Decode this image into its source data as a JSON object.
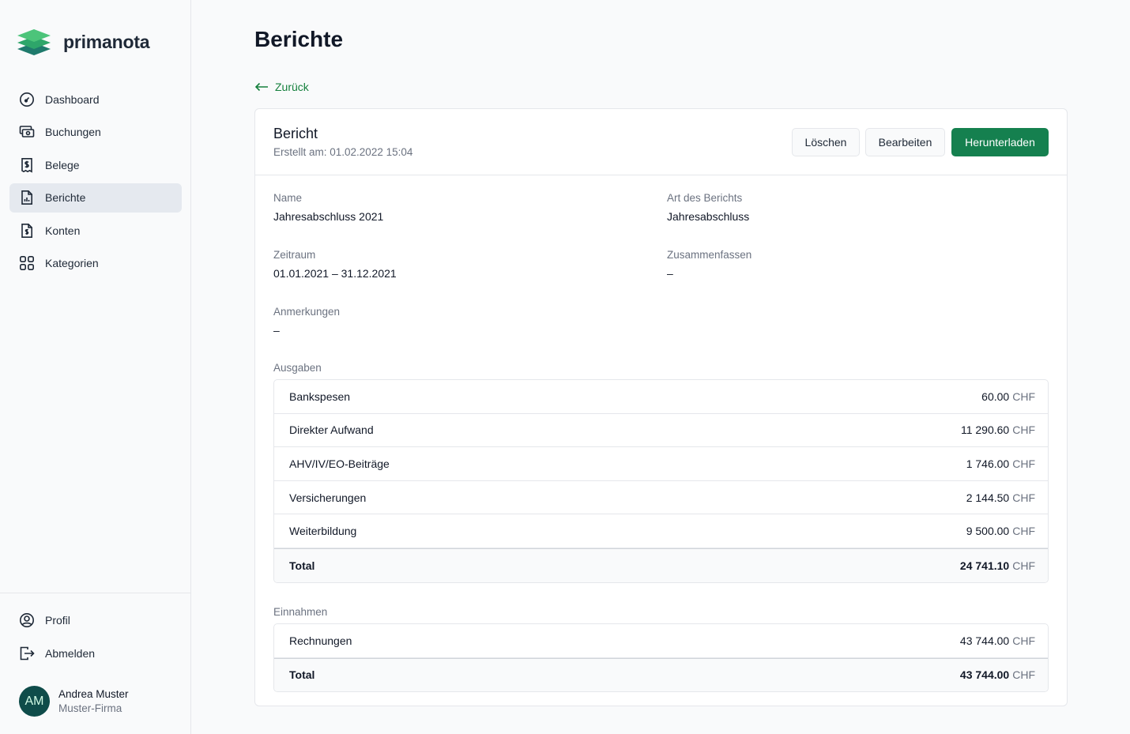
{
  "app": {
    "logo_text": "primanota"
  },
  "sidebar": {
    "items": [
      {
        "label": "Dashboard",
        "icon": "dashboard-gauge-icon",
        "active": false
      },
      {
        "label": "Buchungen",
        "icon": "cash-icon",
        "active": false
      },
      {
        "label": "Belege",
        "icon": "receipt-icon",
        "active": false
      },
      {
        "label": "Berichte",
        "icon": "report-chart-icon",
        "active": true
      },
      {
        "label": "Konten",
        "icon": "document-dollar-icon",
        "active": false
      },
      {
        "label": "Kategorien",
        "icon": "grid-icon",
        "active": false
      }
    ],
    "bottom_items": [
      {
        "label": "Profil",
        "icon": "user-circle-icon"
      },
      {
        "label": "Abmelden",
        "icon": "logout-icon"
      }
    ],
    "user": {
      "initials": "AM",
      "name": "Andrea Muster",
      "company": "Muster-Firma"
    }
  },
  "page": {
    "title": "Berichte",
    "back_label": "Zurück"
  },
  "report": {
    "title": "Bericht",
    "created": "Erstellt am: 01.02.2022 15:04",
    "buttons": {
      "delete": "Löschen",
      "edit": "Bearbeiten",
      "download": "Herunterladen"
    },
    "fields": {
      "name_label": "Name",
      "name_value": "Jahresabschluss 2021",
      "type_label": "Art des Berichts",
      "type_value": "Jahresabschluss",
      "period_label": "Zeitraum",
      "period_value": "01.01.2021 – 31.12.2021",
      "summarize_label": "Zusammenfassen",
      "summarize_value": "–",
      "notes_label": "Anmerkungen",
      "notes_value": "–"
    },
    "expenses": {
      "label": "Ausgaben",
      "rows": [
        {
          "name": "Bankspesen",
          "amount": "60.00",
          "currency": "CHF"
        },
        {
          "name": "Direkter Aufwand",
          "amount": "11 290.60",
          "currency": "CHF"
        },
        {
          "name": "AHV/IV/EO-Beiträge",
          "amount": "1 746.00",
          "currency": "CHF"
        },
        {
          "name": "Versicherungen",
          "amount": "2 144.50",
          "currency": "CHF"
        },
        {
          "name": "Weiterbildung",
          "amount": "9 500.00",
          "currency": "CHF"
        }
      ],
      "total": {
        "name": "Total",
        "amount": "24 741.10",
        "currency": "CHF"
      }
    },
    "income": {
      "label": "Einnahmen",
      "rows": [
        {
          "name": "Rechnungen",
          "amount": "43 744.00",
          "currency": "CHF"
        }
      ],
      "total": {
        "name": "Total",
        "amount": "43 744.00",
        "currency": "CHF"
      }
    }
  },
  "colors": {
    "accent": "#15804f",
    "avatar_bg": "#0f4c4a"
  }
}
